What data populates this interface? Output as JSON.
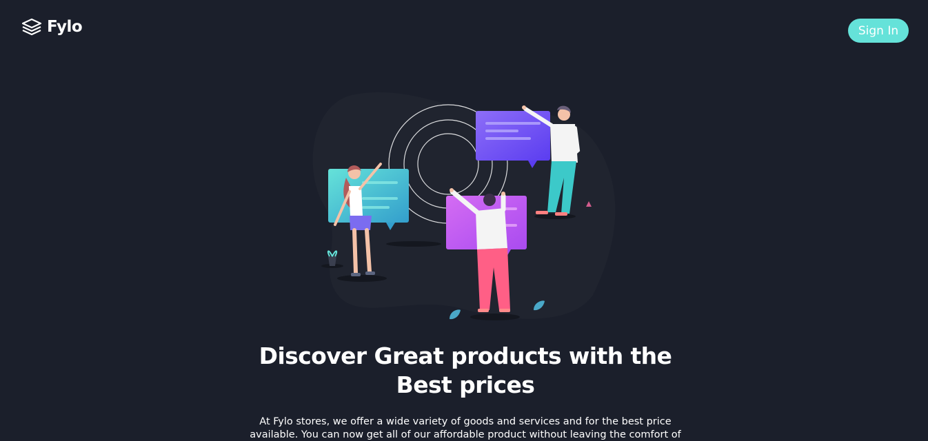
{
  "brand": {
    "name": "Fylo",
    "logo_icon": "stacked-layers-icon"
  },
  "header": {
    "signin_label": "Sign In"
  },
  "hero": {
    "title": "Discover Great products with the Best prices",
    "description": "At Fylo stores, we offer a wide variety of goods and services and for the best price available. You can now get all of our affordable product without leaving the comfort of"
  },
  "colors": {
    "background": "#1b1f2b",
    "accent": "#65e2d9",
    "text": "#ffffff"
  }
}
